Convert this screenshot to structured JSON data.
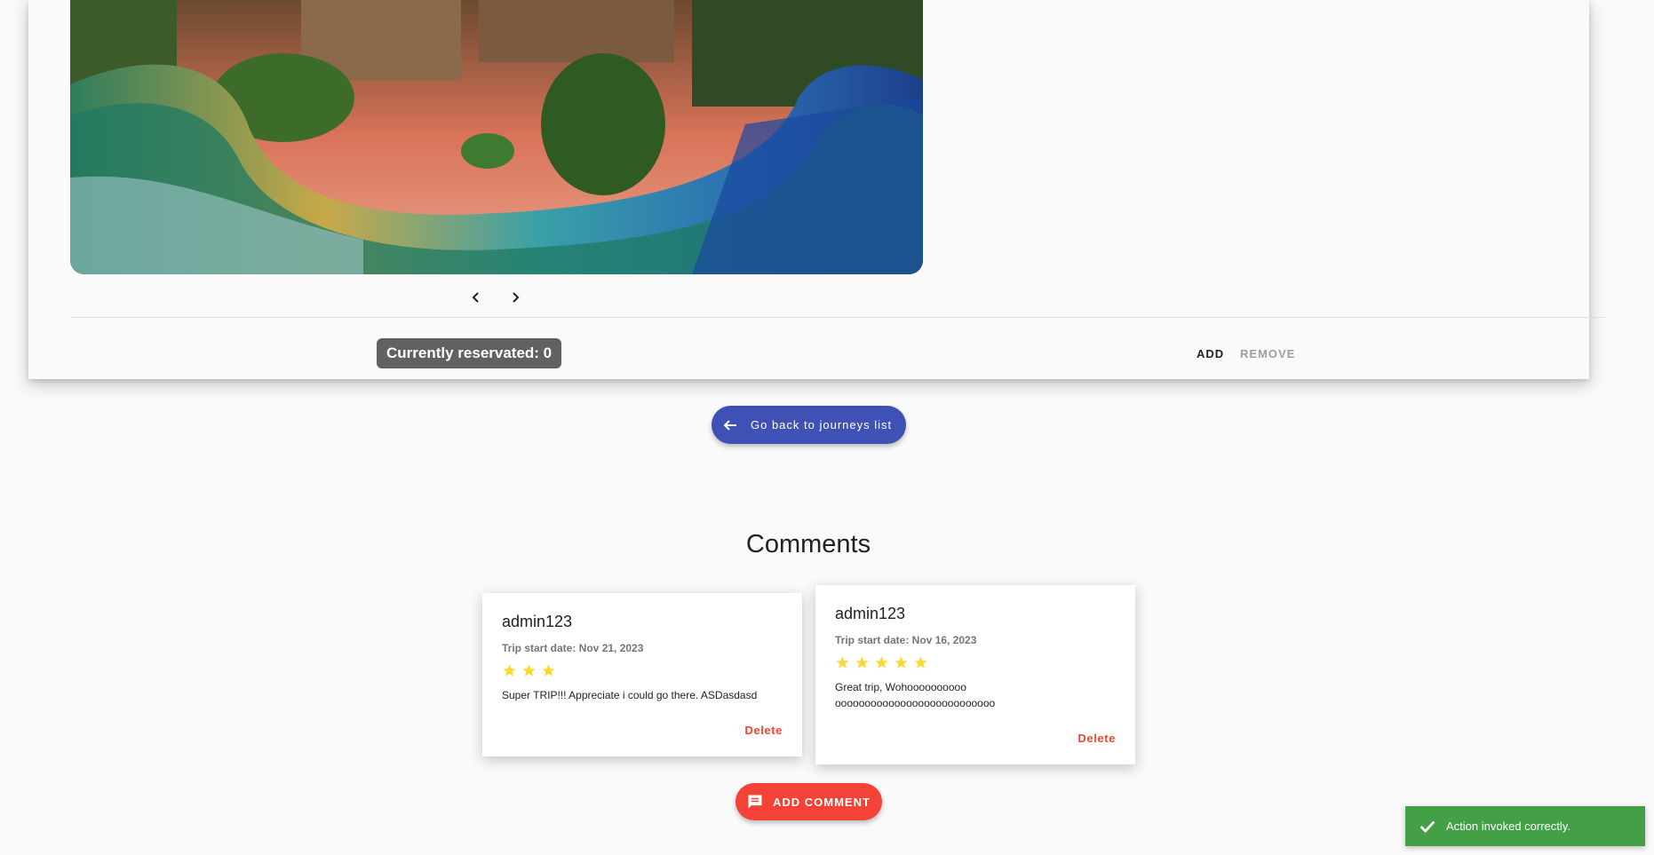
{
  "journey": {
    "reserved_label": "Currently reservated: 0",
    "add_label": "ADD",
    "remove_label": "REMOVE",
    "back_label": "Go back to journeys list"
  },
  "comments": {
    "title": "Comments",
    "items": [
      {
        "user": "admin123",
        "date": "Trip start date: Nov 21, 2023",
        "rating": 3,
        "text": "Super TRIP!!! Appreciate i could go there. ASDasdasd",
        "delete_label": "Delete"
      },
      {
        "user": "admin123",
        "date": "Trip start date: Nov 16, 2023",
        "rating": 5,
        "text": "Great trip, Wohoooooooooo ooooooooooooooooooooooooooo",
        "delete_label": "Delete"
      }
    ],
    "add_label": "ADD COMMENT"
  },
  "toast": {
    "message": "Action invoked correctly."
  },
  "colors": {
    "primary": "#3f51b5",
    "accent": "#f44336",
    "success": "#43a047",
    "star": "#fdd835"
  },
  "icons": [
    "chevron-left-icon",
    "chevron-right-icon",
    "arrow-back-icon",
    "star-icon",
    "comment-icon",
    "check-icon"
  ]
}
